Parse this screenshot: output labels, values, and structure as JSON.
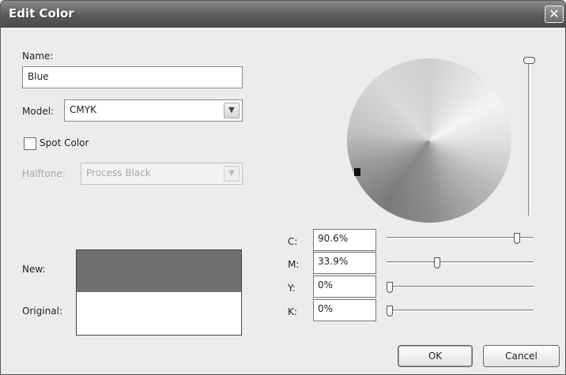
{
  "window": {
    "title": "Edit Color"
  },
  "name": {
    "label": "Name:",
    "value": "Blue"
  },
  "model": {
    "label": "Model:",
    "value": "CMYK"
  },
  "spot_color": {
    "label": "Spot Color",
    "checked": false
  },
  "halftone": {
    "label": "Halftone:",
    "value": "Process Black",
    "enabled": false
  },
  "preview": {
    "new_label": "New:",
    "original_label": "Original:",
    "new_color": "#707070",
    "original_color": "#ffffff"
  },
  "channels": [
    {
      "label": "C:",
      "value": "90.6%",
      "level": 0.906
    },
    {
      "label": "M:",
      "value": "33.9%",
      "level": 0.339
    },
    {
      "label": "Y:",
      "value": "0%",
      "level": 0
    },
    {
      "label": "K:",
      "value": "0%",
      "level": 0
    }
  ],
  "brightness_slider": {
    "level": 1.0
  },
  "buttons": {
    "ok": "OK",
    "cancel": "Cancel"
  },
  "icons": {
    "close": "close-icon",
    "dropdown": "chevron-down-icon"
  }
}
